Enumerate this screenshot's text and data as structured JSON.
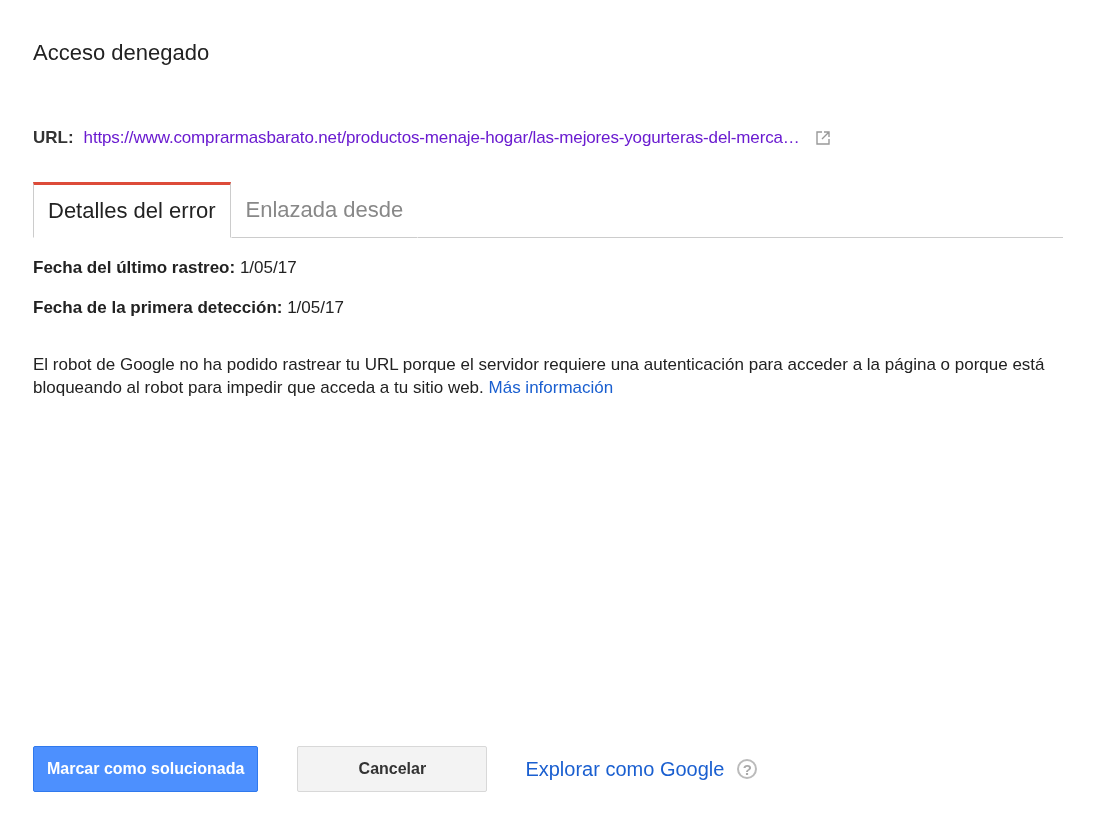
{
  "title": "Acceso denegado",
  "url": {
    "label": "URL:",
    "value": "https://www.comprarmasbarato.net/productos-menaje-hogar/las-mejores-yogurteras-del-merca…"
  },
  "tabs": [
    {
      "label": "Detalles del error",
      "selected": true
    },
    {
      "label": "Enlazada desde",
      "selected": false
    }
  ],
  "details": [
    {
      "label": "Fecha del último rastreo:",
      "value": "1/05/17"
    },
    {
      "label": "Fecha de la primera detección:",
      "value": "1/05/17"
    }
  ],
  "description": {
    "text": "El robot de Google no ha podido rastrear tu URL porque el servidor requiere una autenticación para acceder a la página o porque está bloqueando al robot para impedir que acceda a tu sitio web.",
    "link": "Más información"
  },
  "actions": {
    "primary": "Marcar como solucionada",
    "secondary": "Cancelar",
    "link": "Explorar como Google",
    "help": "?"
  }
}
